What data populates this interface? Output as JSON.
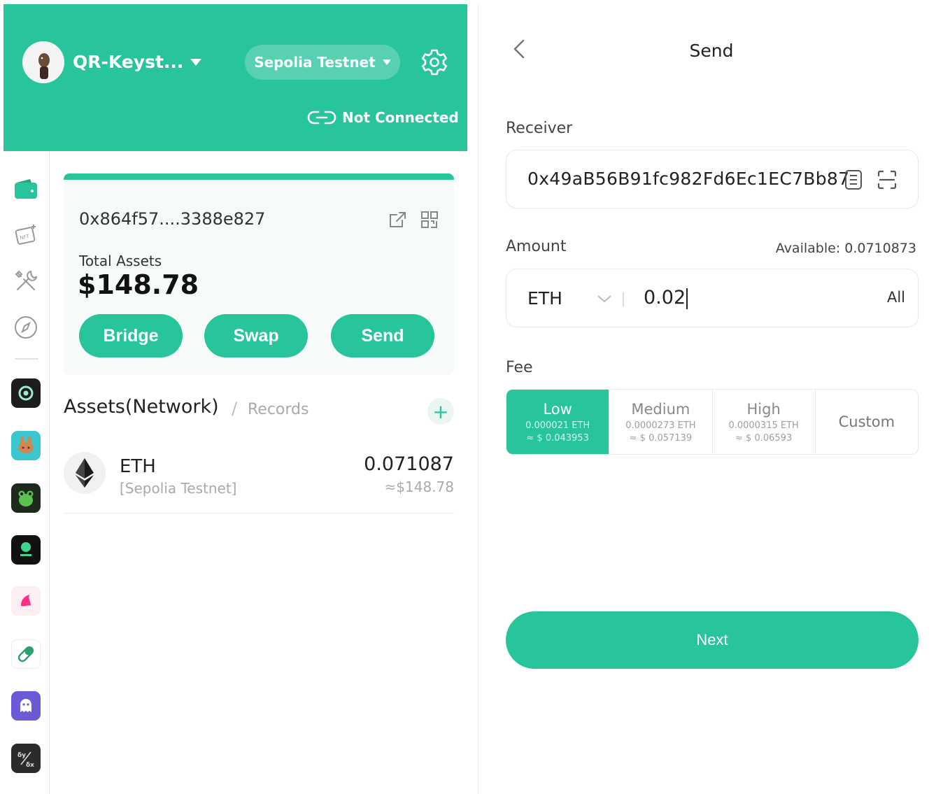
{
  "colors": {
    "accent": "#28c49c",
    "header_text": "#ffffff",
    "muted": "#aaaaaa"
  },
  "header": {
    "account_name": "QR-Keyst...",
    "network": "Sepolia Testnet",
    "connection_status": "Not Connected"
  },
  "sidebar": {
    "nav_items": [
      {
        "icon": "wallet-icon"
      },
      {
        "icon": "nft-icon"
      },
      {
        "icon": "tools-icon"
      },
      {
        "icon": "compass-icon"
      }
    ],
    "apps": [
      {
        "icon": "app-1-icon",
        "color": "#1d1d1d"
      },
      {
        "icon": "app-2-icon",
        "color": "#3cc6cf"
      },
      {
        "icon": "app-3-icon",
        "color": "#1e2a1e"
      },
      {
        "icon": "app-4-icon",
        "color": "#111111"
      },
      {
        "icon": "app-5-icon",
        "color": "#fdeef3"
      },
      {
        "icon": "app-6-icon",
        "color": "#ffffff"
      },
      {
        "icon": "app-7-icon",
        "color": "#6a5ad6"
      },
      {
        "icon": "app-8-icon",
        "color": "#2b2b2b"
      }
    ]
  },
  "account": {
    "address": "0x864f57....3388e827",
    "total_label": "Total Assets",
    "total_value": "$148.78",
    "actions": {
      "bridge": "Bridge",
      "swap": "Swap",
      "send": "Send"
    }
  },
  "assets": {
    "tab_assets": "Assets(Network)",
    "tab_separator": "/",
    "tab_records": "Records",
    "add_symbol": "+",
    "items": [
      {
        "symbol": "ETH",
        "network": "[Sepolia Testnet]",
        "amount": "0.071087",
        "fiat": "≈$148.78"
      }
    ]
  },
  "send": {
    "title": "Send",
    "receiver_label": "Receiver",
    "receiver_value": "0x49aB56B91fc982Fd6Ec1EC7Bb87",
    "amount_label": "Amount",
    "available": "Available: 0.0710873",
    "token": "ETH",
    "amount_value": "0.02",
    "all_label": "All",
    "fee_label": "Fee",
    "fee_options": [
      {
        "name": "Low",
        "eth": "0.000021 ETH",
        "usd": "≈ $ 0.043953",
        "selected": true
      },
      {
        "name": "Medium",
        "eth": "0.0000273 ETH",
        "usd": "≈ $ 0.057139",
        "selected": false
      },
      {
        "name": "High",
        "eth": "0.0000315 ETH",
        "usd": "≈ $ 0.06593",
        "selected": false
      }
    ],
    "fee_custom": "Custom",
    "next_label": "Next"
  }
}
